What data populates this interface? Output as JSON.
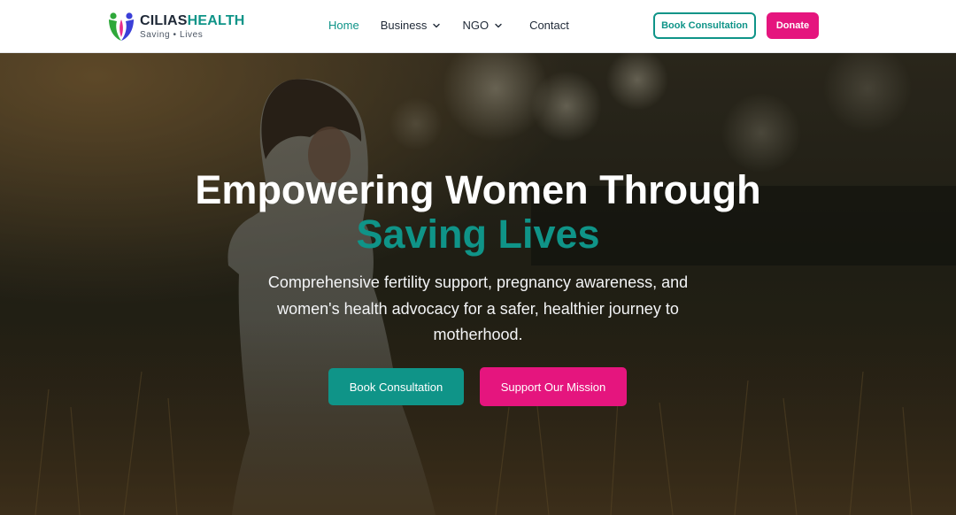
{
  "header": {
    "brand_part1": "CILIAS",
    "brand_part2": "HEALTH",
    "tagline": "Saving • Lives",
    "nav": {
      "home": "Home",
      "business": "Business",
      "ngo": "NGO",
      "contact": "Contact"
    },
    "book_button": "Book Consultation",
    "donate_button": "Donate"
  },
  "hero": {
    "title_line1": "Empowering Women Through",
    "title_line2": "Saving Lives",
    "subtitle": "Comprehensive fertility support, pregnancy awareness, and women's health advocacy for a safer, healthier journey to motherhood.",
    "primary_button": "Book Consultation",
    "secondary_button": "Support Our Mission"
  },
  "colors": {
    "teal": "#0f9488",
    "pink": "#e5157e",
    "blue": "#3b3fd8",
    "green": "#2fa83a"
  }
}
